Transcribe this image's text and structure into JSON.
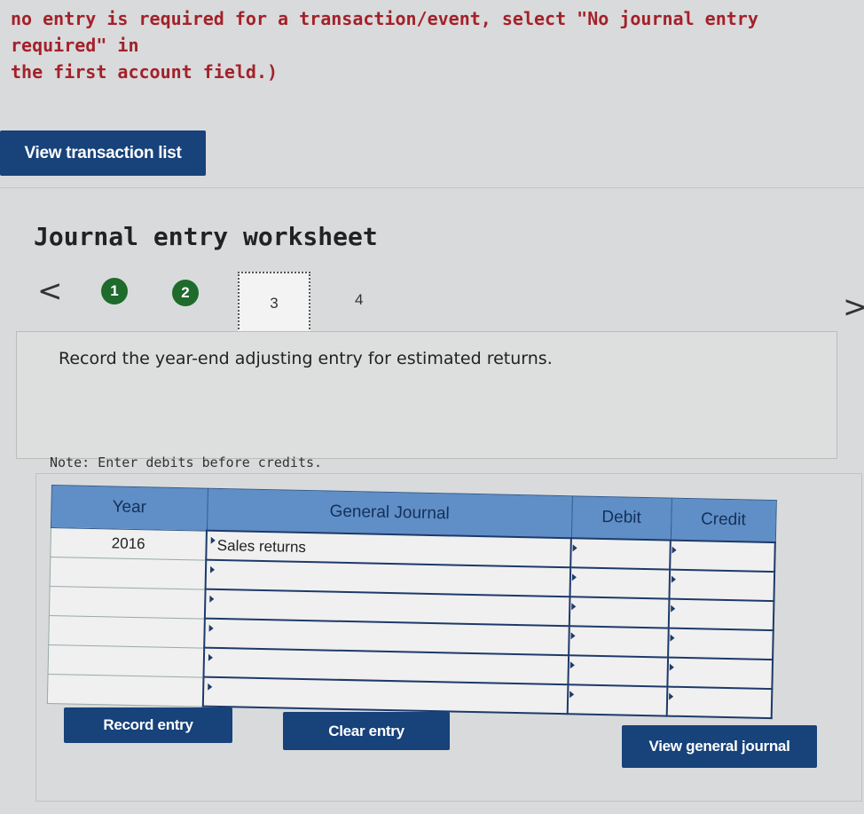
{
  "instructions": {
    "line1": "no entry is required for a transaction/event, select \"No journal entry required\" in",
    "line2": "the first account field.)"
  },
  "buttons": {
    "view_transaction_list": "View transaction list",
    "record_entry": "Record entry",
    "clear_entry": "Clear entry",
    "view_general_journal": "View general journal"
  },
  "worksheet": {
    "title": "Journal entry worksheet",
    "prev": "<",
    "next": ">",
    "steps": [
      "1",
      "2",
      "3",
      "4"
    ],
    "current_step": 3,
    "task": "Record the year-end adjusting entry for estimated returns.",
    "note": "Note: Enter debits before credits."
  },
  "table": {
    "headers": {
      "year": "Year",
      "journal": "General Journal",
      "debit": "Debit",
      "credit": "Credit"
    },
    "rows": [
      {
        "year": "2016",
        "account": "Sales returns",
        "debit": "",
        "credit": ""
      },
      {
        "year": "",
        "account": "",
        "debit": "",
        "credit": ""
      },
      {
        "year": "",
        "account": "",
        "debit": "",
        "credit": ""
      },
      {
        "year": "",
        "account": "",
        "debit": "",
        "credit": ""
      },
      {
        "year": "",
        "account": "",
        "debit": "",
        "credit": ""
      },
      {
        "year": "",
        "account": "",
        "debit": "",
        "credit": ""
      }
    ]
  },
  "colors": {
    "primary_button": "#17427a",
    "header_blue": "#5f8fc6",
    "completed_step": "#1e6b2c",
    "instruction_red": "#a3212a"
  }
}
